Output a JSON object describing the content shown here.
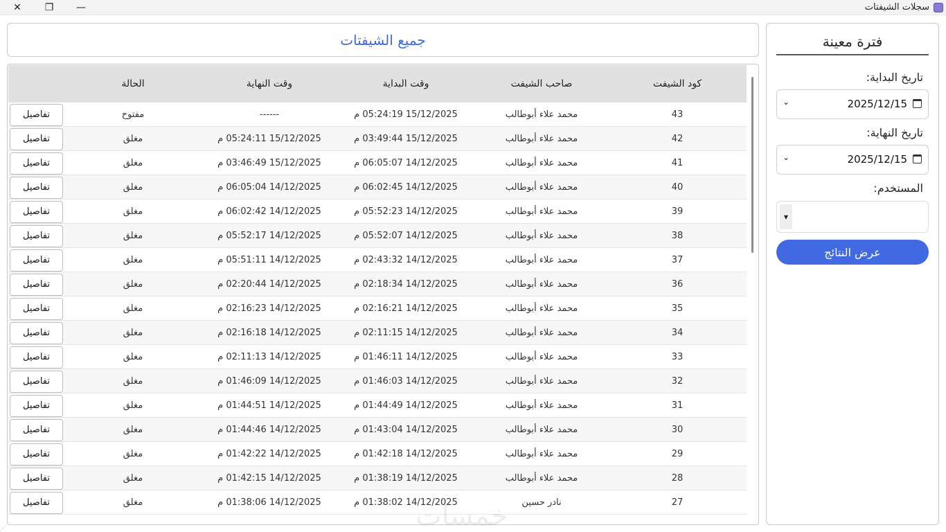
{
  "window": {
    "title": "سجلات الشيفتات",
    "close": "✕",
    "restore": "❐",
    "minimize": "—"
  },
  "filter": {
    "title": "فترة معينة",
    "start_label": "تاريخ البداية:",
    "start_value": "2025/12/15",
    "end_label": "تاريخ النهاية:",
    "end_value": "2025/12/15",
    "user_label": "المستخدم:",
    "user_value": "",
    "button": "عرض النتائج"
  },
  "header": {
    "title": "جميع الشيفتات"
  },
  "table": {
    "columns": {
      "code": "كود الشيفت",
      "owner": "صاحب الشيفت",
      "start": "وقت البداية",
      "end": "وقت النهاية",
      "status": "الحالة",
      "action": ""
    },
    "rows": [
      {
        "code": "43",
        "owner": "محمد علاء أبوطالب",
        "start": "15/12/2025 05:24:19 م",
        "end": "------",
        "status": "مفتوح",
        "action": "تفاصيل"
      },
      {
        "code": "42",
        "owner": "محمد علاء أبوطالب",
        "start": "15/12/2025 03:49:44 م",
        "end": "15/12/2025 05:24:11 م",
        "status": "مغلق",
        "action": "تفاصيل"
      },
      {
        "code": "41",
        "owner": "محمد علاء أبوطالب",
        "start": "14/12/2025 06:05:07 م",
        "end": "15/12/2025 03:46:49 م",
        "status": "مغلق",
        "action": "تفاصيل"
      },
      {
        "code": "40",
        "owner": "محمد علاء أبوطالب",
        "start": "14/12/2025 06:02:45 م",
        "end": "14/12/2025 06:05:04 م",
        "status": "مغلق",
        "action": "تفاصيل"
      },
      {
        "code": "39",
        "owner": "محمد علاء أبوطالب",
        "start": "14/12/2025 05:52:23 م",
        "end": "14/12/2025 06:02:42 م",
        "status": "مغلق",
        "action": "تفاصيل"
      },
      {
        "code": "38",
        "owner": "محمد علاء أبوطالب",
        "start": "14/12/2025 05:52:07 م",
        "end": "14/12/2025 05:52:17 م",
        "status": "مغلق",
        "action": "تفاصيل"
      },
      {
        "code": "37",
        "owner": "محمد علاء أبوطالب",
        "start": "14/12/2025 02:43:32 م",
        "end": "14/12/2025 05:51:11 م",
        "status": "مغلق",
        "action": "تفاصيل"
      },
      {
        "code": "36",
        "owner": "محمد علاء أبوطالب",
        "start": "14/12/2025 02:18:34 م",
        "end": "14/12/2025 02:20:44 م",
        "status": "مغلق",
        "action": "تفاصيل"
      },
      {
        "code": "35",
        "owner": "محمد علاء أبوطالب",
        "start": "14/12/2025 02:16:21 م",
        "end": "14/12/2025 02:16:23 م",
        "status": "مغلق",
        "action": "تفاصيل"
      },
      {
        "code": "34",
        "owner": "محمد علاء أبوطالب",
        "start": "14/12/2025 02:11:15 م",
        "end": "14/12/2025 02:16:18 م",
        "status": "مغلق",
        "action": "تفاصيل"
      },
      {
        "code": "33",
        "owner": "محمد علاء أبوطالب",
        "start": "14/12/2025 01:46:11 م",
        "end": "14/12/2025 02:11:13 م",
        "status": "مغلق",
        "action": "تفاصيل"
      },
      {
        "code": "32",
        "owner": "محمد علاء أبوطالب",
        "start": "14/12/2025 01:46:03 م",
        "end": "14/12/2025 01:46:09 م",
        "status": "مغلق",
        "action": "تفاصيل"
      },
      {
        "code": "31",
        "owner": "محمد علاء أبوطالب",
        "start": "14/12/2025 01:44:49 م",
        "end": "14/12/2025 01:44:51 م",
        "status": "مغلق",
        "action": "تفاصيل"
      },
      {
        "code": "30",
        "owner": "محمد علاء أبوطالب",
        "start": "14/12/2025 01:43:04 م",
        "end": "14/12/2025 01:44:46 م",
        "status": "مغلق",
        "action": "تفاصيل"
      },
      {
        "code": "29",
        "owner": "محمد علاء أبوطالب",
        "start": "14/12/2025 01:42:18 م",
        "end": "14/12/2025 01:42:22 م",
        "status": "مغلق",
        "action": "تفاصيل"
      },
      {
        "code": "28",
        "owner": "محمد علاء أبوطالب",
        "start": "14/12/2025 01:38:19 م",
        "end": "14/12/2025 01:42:15 م",
        "status": "مغلق",
        "action": "تفاصيل"
      },
      {
        "code": "27",
        "owner": "نادر حسين",
        "start": "14/12/2025 01:38:02 م",
        "end": "14/12/2025 01:38:06 م",
        "status": "مغلق",
        "action": "تفاصيل"
      }
    ]
  },
  "watermark": "خمسات"
}
